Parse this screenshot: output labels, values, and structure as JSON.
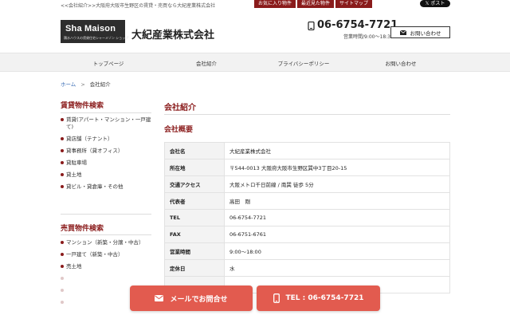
{
  "header": {
    "breadcrumb_top": "<<会社紹介>>大阪府大阪市生野区の賃貸・売買なら大紀産業株式会社",
    "top_links": [
      "お気に入り物件",
      "最近見た物件",
      "サイトマップ"
    ],
    "x_post_label": "𝕏 ポスト",
    "logo_text": "Sha Maison",
    "logo_sub": "積水ハウスの賃貸住宅シャーメゾン ショップ",
    "company_name": "大紀産業株式会社",
    "phone": "06-6754-7721",
    "hours": "営業時間/9:00〜18:30",
    "contact_label": "お問い合わせ"
  },
  "nav": {
    "items": [
      "トップページ",
      "会社紹介",
      "プライバシーポリシー",
      "お問い合わせ"
    ]
  },
  "breadcrumb": {
    "home": "ホーム",
    "separator": ">",
    "current": "会社紹介"
  },
  "sidebar": {
    "rental_heading": "賃貸物件検索",
    "rental_items": [
      "賃貸(アパート・マンション・一戸建て)",
      "貸店舗（テナント）",
      "貸事務所（貸オフィス）",
      "貸駐車場",
      "貸土地",
      "貸ビル・貸倉庫・その他"
    ],
    "sale_heading": "売買物件検索",
    "sale_items": [
      "マンション（新築・分譲・中古）",
      "一戸建て（新築・中古）",
      "売土地"
    ]
  },
  "main": {
    "title": "会社紹介",
    "subtitle": "会社概要",
    "rows": [
      {
        "label": "会社名",
        "value": "大紀産業株式会社"
      },
      {
        "label": "所在地",
        "value": "〒544-0013 大阪府大阪市生野区巽中3丁目20-15"
      },
      {
        "label": "交通アクセス",
        "value": "大阪メトロ千日前線 / 南巽 徒歩 5分"
      },
      {
        "label": "代表者",
        "value": "高田　剛"
      },
      {
        "label": "TEL",
        "value": "06-6754-7721"
      },
      {
        "label": "FAX",
        "value": "06-6751-6761"
      },
      {
        "label": "営業時間",
        "value": "9:00〜18:00"
      },
      {
        "label": "定休日",
        "value": "水"
      }
    ]
  },
  "cta": {
    "mail_label": "メールでお問合せ",
    "tel_label": "TEL : 06-6754-7721"
  },
  "colors": {
    "brand": "#8a1b1b",
    "cta": "#e25b4f",
    "link": "#3a6db5"
  }
}
